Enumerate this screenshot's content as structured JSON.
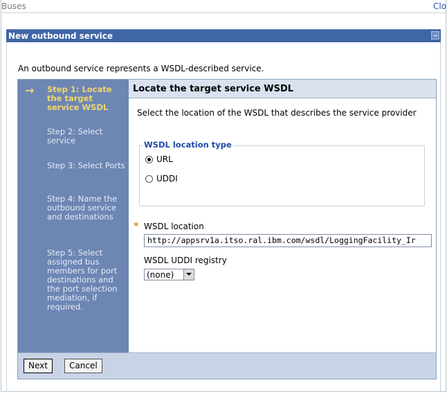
{
  "header": {
    "title": "Buses",
    "close_label": "Clo"
  },
  "portlet": {
    "title": "New outbound service"
  },
  "intro_text": "An outbound service represents a WSDL-described service.",
  "wizard": {
    "steps": [
      {
        "label": "Step 1: Locate the target service WSDL",
        "current": true
      },
      {
        "label": "Step 2: Select service",
        "current": false
      },
      {
        "label": "Step 3: Select Ports",
        "current": false
      },
      {
        "label": "Step 4: Name the outbound service and destinations",
        "current": false
      },
      {
        "label": "Step 5: Select assigned bus members for port destinations and the port selection mediation, if required.",
        "current": false
      }
    ],
    "current_marker": "→",
    "content_title": "Locate the target service WSDL",
    "description": "Select the location of the WSDL that describes the service provider",
    "location_type": {
      "legend": "WSDL location type",
      "options": [
        {
          "label": "URL",
          "checked": true
        },
        {
          "label": "UDDI",
          "checked": false
        }
      ]
    },
    "required_marker": "*",
    "wsdl_location": {
      "label": "WSDL location",
      "value": "http://appsrv1a.itso.ral.ibm.com/wsdl/LoggingFacility_Ir"
    },
    "uddi_registry": {
      "label": "WSDL UDDI registry",
      "selected": "(none)"
    },
    "buttons": {
      "next": "Next",
      "cancel": "Cancel"
    }
  },
  "colors": {
    "portlet_bar": "#3f66a5",
    "steps_panel": "#6d86b4",
    "current_step": "#f3d66b",
    "content_header": "#d9e2ee",
    "footer": "#c8d4e6"
  }
}
